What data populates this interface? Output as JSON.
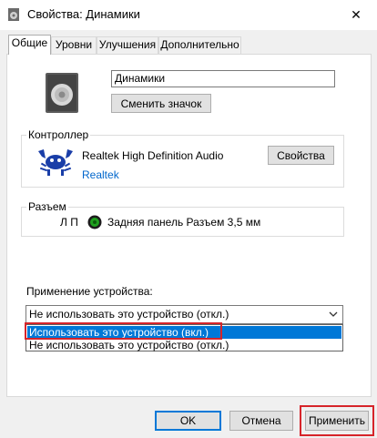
{
  "window": {
    "title": "Свойства: Динамики",
    "close_glyph": "✕"
  },
  "tabs": [
    {
      "label": "Общие",
      "active": true
    },
    {
      "label": "Уровни",
      "active": false
    },
    {
      "label": "Улучшения",
      "active": false
    },
    {
      "label": "Дополнительно",
      "active": false
    }
  ],
  "general": {
    "device_name": "Динамики",
    "change_icon_label": "Сменить значок",
    "controller": {
      "label": "Контроллер",
      "name": "Realtek High Definition Audio",
      "vendor_link": "Realtek",
      "properties_label": "Свойства"
    },
    "jack": {
      "label": "Разъем",
      "channel": "Л П",
      "description": "Задняя панель Разъем 3,5 мм",
      "jack_color": "#1ea11e"
    },
    "usage": {
      "label": "Применение устройства:",
      "selected_value": "Не использовать это устройство (откл.)",
      "options": [
        "Использовать это устройство (вкл.)",
        "Не использовать это устройство (откл.)"
      ]
    }
  },
  "buttons": {
    "ok": "OK",
    "cancel": "Отмена",
    "apply": "Применить"
  },
  "colors": {
    "accent": "#0078d7",
    "highlight_red": "#d6242a",
    "link": "#0066cc",
    "realtek_logo": "#1a3ea8"
  },
  "icons": {
    "window": "speaker-icon",
    "close": "close-icon",
    "device": "speaker-icon",
    "controller": "realtek-crab-icon",
    "jack": "jack-green-icon",
    "combo": "chevron-down-icon"
  }
}
